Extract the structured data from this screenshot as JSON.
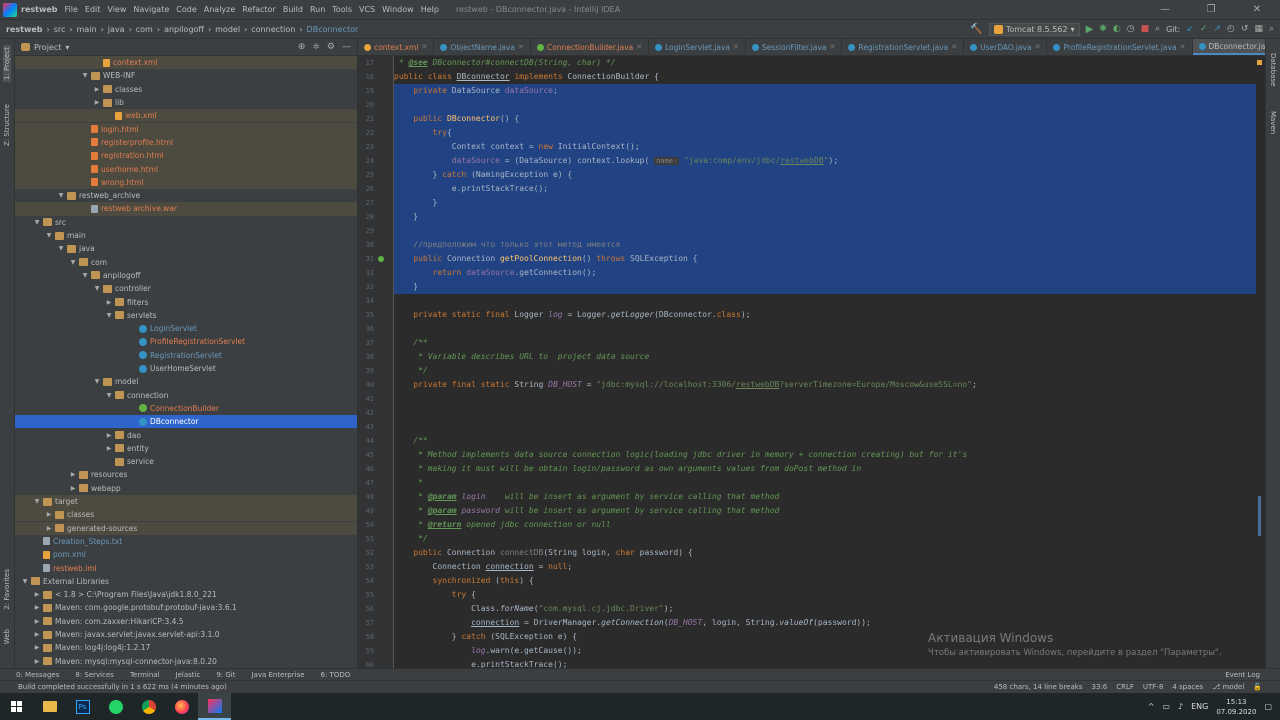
{
  "titlebar": {
    "project": "restweb",
    "menu": [
      "File",
      "Edit",
      "View",
      "Navigate",
      "Code",
      "Analyze",
      "Refactor",
      "Build",
      "Run",
      "Tools",
      "VCS",
      "Window",
      "Help"
    ],
    "title": "restweb - DBconnector.java - IntelliJ IDEA"
  },
  "navbar": {
    "crumbs": [
      "restweb",
      "src",
      "main",
      "java",
      "com",
      "anpilogoff",
      "model",
      "connection",
      "DBconnector"
    ],
    "run_config": "Tomcat 8.5.562",
    "git_label": "Git:"
  },
  "stripes": {
    "left_top": "1: Project",
    "left_structure": "Z: Structure",
    "left_favorites": "2: Favorites",
    "left_web": "Web",
    "right_database": "Database",
    "right_maven": "Maven"
  },
  "project_panel": {
    "title": "Project",
    "rows": [
      {
        "label": "context.xml",
        "color": "orange",
        "icon": "file-xml",
        "indent": 6,
        "arrow": ""
      },
      {
        "label": "WEB-INF",
        "color": "normal",
        "icon": "folder",
        "indent": 5,
        "arrow": "▼"
      },
      {
        "label": "classes",
        "color": "normal",
        "icon": "folder",
        "indent": 6,
        "arrow": "▶"
      },
      {
        "label": "lib",
        "color": "normal",
        "icon": "folder",
        "indent": 6,
        "arrow": "▶"
      },
      {
        "label": "web.xml",
        "color": "orange",
        "icon": "file-xml",
        "indent": 7,
        "arrow": ""
      },
      {
        "label": "login.html",
        "color": "orange",
        "icon": "file-html",
        "indent": 5,
        "arrow": ""
      },
      {
        "label": "registerprofile.html",
        "color": "orange",
        "icon": "file-html",
        "indent": 5,
        "arrow": ""
      },
      {
        "label": "registration.html",
        "color": "orange",
        "icon": "file-html",
        "indent": 5,
        "arrow": ""
      },
      {
        "label": "userhome.html",
        "color": "orange",
        "icon": "file-html",
        "indent": 5,
        "arrow": ""
      },
      {
        "label": "wrong.html",
        "color": "orange",
        "icon": "file-html",
        "indent": 5,
        "arrow": ""
      },
      {
        "label": "restweb_archive",
        "color": "normal",
        "icon": "folder",
        "indent": 3,
        "arrow": "▼"
      },
      {
        "label": "restweb archive.war",
        "color": "orange",
        "icon": "file-war",
        "indent": 5,
        "arrow": ""
      },
      {
        "label": "src",
        "color": "normal",
        "icon": "folder",
        "indent": 1,
        "arrow": "▼"
      },
      {
        "label": "main",
        "color": "normal",
        "icon": "folder",
        "indent": 2,
        "arrow": "▼"
      },
      {
        "label": "java",
        "color": "normal",
        "icon": "folder",
        "indent": 3,
        "arrow": "▼"
      },
      {
        "label": "com",
        "color": "normal",
        "icon": "folder",
        "indent": 4,
        "arrow": "▼"
      },
      {
        "label": "anpilogoff",
        "color": "normal",
        "icon": "folder",
        "indent": 5,
        "arrow": "▼"
      },
      {
        "label": "controller",
        "color": "normal",
        "icon": "folder",
        "indent": 6,
        "arrow": "▼"
      },
      {
        "label": "filters",
        "color": "normal",
        "icon": "folder",
        "indent": 7,
        "arrow": "▶"
      },
      {
        "label": "servlets",
        "color": "normal",
        "icon": "folder",
        "indent": 7,
        "arrow": "▼"
      },
      {
        "label": "LoginServlet",
        "color": "blue",
        "icon": "cls",
        "indent": 9,
        "arrow": ""
      },
      {
        "label": "ProfileRegistrationServlet",
        "color": "orange",
        "icon": "cls",
        "indent": 9,
        "arrow": ""
      },
      {
        "label": "RegistrationServlet",
        "color": "blue",
        "icon": "cls",
        "indent": 9,
        "arrow": ""
      },
      {
        "label": "UserHomeServlet",
        "color": "normal",
        "icon": "cls",
        "indent": 9,
        "arrow": ""
      },
      {
        "label": "model",
        "color": "normal",
        "icon": "folder",
        "indent": 6,
        "arrow": "▼"
      },
      {
        "label": "connection",
        "color": "normal",
        "icon": "folder",
        "indent": 7,
        "arrow": "▼"
      },
      {
        "label": "ConnectionBuilder",
        "color": "orange",
        "icon": "iface",
        "indent": 9,
        "arrow": ""
      },
      {
        "label": "DBconnector",
        "color": "normal",
        "icon": "cls",
        "indent": 9,
        "arrow": "",
        "selected": true
      },
      {
        "label": "dao",
        "color": "normal",
        "icon": "folder",
        "indent": 7,
        "arrow": "▶"
      },
      {
        "label": "entity",
        "color": "normal",
        "icon": "folder",
        "indent": 7,
        "arrow": "▶"
      },
      {
        "label": "service",
        "color": "normal",
        "icon": "folder",
        "indent": 7,
        "arrow": ""
      },
      {
        "label": "resources",
        "color": "normal",
        "icon": "folder",
        "indent": 4,
        "arrow": "▶"
      },
      {
        "label": "webapp",
        "color": "normal",
        "icon": "folder",
        "indent": 4,
        "arrow": "▶"
      },
      {
        "label": "target",
        "color": "normal",
        "icon": "folder",
        "indent": 1,
        "arrow": "▼",
        "hl": true
      },
      {
        "label": "classes",
        "color": "normal",
        "icon": "folder",
        "indent": 2,
        "arrow": "▶",
        "hl": true
      },
      {
        "label": "generated-sources",
        "color": "normal",
        "icon": "folder",
        "indent": 2,
        "arrow": "▶",
        "hl": true
      },
      {
        "label": "Creation_Steps.txt",
        "color": "blue",
        "icon": "file-war",
        "indent": 1,
        "arrow": ""
      },
      {
        "label": "pom.xml",
        "color": "blue",
        "icon": "file-xml",
        "indent": 1,
        "arrow": ""
      },
      {
        "label": "restweb.iml",
        "color": "orange",
        "icon": "file-war",
        "indent": 1,
        "arrow": ""
      },
      {
        "label": "External Libraries",
        "color": "normal",
        "icon": "folder",
        "indent": 0,
        "arrow": "▼"
      },
      {
        "label": "< 1.8 >  C:\\Program Files\\Java\\jdk1.8.0_221",
        "color": "normal",
        "icon": "folder",
        "indent": 1,
        "arrow": "▶"
      },
      {
        "label": "Maven: com.google.protobuf:protobuf-java:3.6.1",
        "color": "normal",
        "icon": "folder",
        "indent": 1,
        "arrow": "▶"
      },
      {
        "label": "Maven: com.zaxxer:HikariCP:3.4.5",
        "color": "normal",
        "icon": "folder",
        "indent": 1,
        "arrow": "▶"
      },
      {
        "label": "Maven: javax.servlet:javax.servlet-api:3.1.0",
        "color": "normal",
        "icon": "folder",
        "indent": 1,
        "arrow": "▶"
      },
      {
        "label": "Maven: log4j:log4j:1.2.17",
        "color": "normal",
        "icon": "folder",
        "indent": 1,
        "arrow": "▶"
      },
      {
        "label": "Maven: mysql:mysql-connector-java:8.0.20",
        "color": "normal",
        "icon": "folder",
        "indent": 1,
        "arrow": "▶"
      }
    ]
  },
  "tabs": [
    {
      "label": "context.xml",
      "color": "#e8a33c"
    },
    {
      "label": "ObjectName.java",
      "color": "#3592c4"
    },
    {
      "label": "ConnectionBuilder.java",
      "color": "#62b543"
    },
    {
      "label": "LoginServlet.java",
      "color": "#3592c4"
    },
    {
      "label": "SessionFilter.java",
      "color": "#3592c4"
    },
    {
      "label": "RegistrationServlet.java",
      "color": "#3592c4"
    },
    {
      "label": "UserDAO.java",
      "color": "#3592c4"
    },
    {
      "label": "ProfileRegistrationServlet.java",
      "color": "#3592c4"
    },
    {
      "label": "DBconnector.java",
      "color": "#3592c4",
      "active": true
    }
  ],
  "code": {
    "lines": [
      {
        "n": "17",
        "html": "<span class='doc'> * <span class='tag'>@see</span> DBconnector#connectDB(String, char) */</span>"
      },
      {
        "n": "18",
        "html": "<span class='kw'>public class</span> <span class='ul'>DBconnector</span> <span class='kw'>implements</span> ConnectionBuilder {"
      },
      {
        "n": "19",
        "html": "    <span class='kw'>private</span> DataSource <span class='fld'>dataSource</span>;",
        "sel": true
      },
      {
        "n": "20",
        "html": "",
        "sel": true
      },
      {
        "n": "21",
        "html": "    <span class='kw'>public</span> <span class='fn'>DBconnector</span>() {",
        "sel": true
      },
      {
        "n": "22",
        "html": "        <span class='kw'>try</span>{",
        "sel": true
      },
      {
        "n": "23",
        "html": "            Context context = <span class='kw'>new</span> InitialContext();",
        "sel": true
      },
      {
        "n": "24",
        "html": "            <span class='fld'>dataSource</span> = (DataSource) context.lookup( <span class='hint'>name:</span> <span class='str'>\"java:comp/env/jdbc/<span class='ul'>restwebDB</span>\"</span>);",
        "sel": true
      },
      {
        "n": "25",
        "html": "        } <span class='kw'>catch</span> (NamingException e) {",
        "sel": true
      },
      {
        "n": "26",
        "html": "            e.printStackTrace();",
        "sel": true
      },
      {
        "n": "27",
        "html": "        }",
        "sel": true
      },
      {
        "n": "28",
        "html": "    }",
        "sel": true
      },
      {
        "n": "29",
        "html": "",
        "sel": true
      },
      {
        "n": "30",
        "html": "    <span class='cmt'>//предположим что только этот метод имеется</span>",
        "sel": true
      },
      {
        "n": "31",
        "html": "    <span class='kw'>public</span> Connection <span class='fn'>getPoolConnection</span>() <span class='kw'>throws</span> SQLException {",
        "sel": true
      },
      {
        "n": "32",
        "html": "        <span class='kw'>return</span> <span class='fld'>dataSource</span>.getConnection();",
        "sel": true
      },
      {
        "n": "33",
        "html": "    }",
        "sel": true,
        "cur": true
      },
      {
        "n": "34",
        "html": ""
      },
      {
        "n": "35",
        "html": "    <span class='kw'>private static final</span> Logger <span class='fld it'>log</span> = Logger.<span class='it'>getLogger</span>(DBconnector.<span class='kw'>class</span>);"
      },
      {
        "n": "36",
        "html": ""
      },
      {
        "n": "37",
        "html": "    <span class='doc'>/**</span>"
      },
      {
        "n": "38",
        "html": "    <span class='doc'> * Variable describes URL to  project data source</span>"
      },
      {
        "n": "39",
        "html": "    <span class='doc'> */</span>"
      },
      {
        "n": "40",
        "html": "    <span class='kw'>private final static</span> String <span class='fld it'>DB_HOST</span> = <span class='str'>\"jdbc:mysql://localhost:3306/<span class='ul'>restwebDB</span>?serverTimezone=Europe/Moscow&amp;useSSL=no\"</span>;"
      },
      {
        "n": "41",
        "html": ""
      },
      {
        "n": "42",
        "html": ""
      },
      {
        "n": "43",
        "html": ""
      },
      {
        "n": "44",
        "html": "    <span class='doc'>/**</span>"
      },
      {
        "n": "45",
        "html": "    <span class='doc'> * Method implements data source connection logic(loading jdbc driver in memory + connection creating) but for it's</span>"
      },
      {
        "n": "46",
        "html": "    <span class='doc'> * making it must will be obtain login/password as own arguments values from doPost method in</span>"
      },
      {
        "n": "47",
        "html": "    <span class='doc'> *</span>"
      },
      {
        "n": "48",
        "html": "    <span class='doc'> * <span class='tag'>@param</span> <span class='fld'>login</span>    will be insert as argument by service calling that method</span>"
      },
      {
        "n": "49",
        "html": "    <span class='doc'> * <span class='tag'>@param</span> <span class='fld'>password</span> will be insert as argument by service calling that method</span>"
      },
      {
        "n": "50",
        "html": "    <span class='doc'> * <span class='tag'>@return</span> opened jdbc connection or null</span>"
      },
      {
        "n": "51",
        "html": "    <span class='doc'> */</span>"
      },
      {
        "n": "52",
        "html": "    <span class='kw'>public</span> Connection <span class='cmt'>connectDB</span>(String login, <span class='kw'>char</span> password) {"
      },
      {
        "n": "53",
        "html": "        Connection <span class='ul'>connection</span> = <span class='kw'>null</span>;"
      },
      {
        "n": "54",
        "html": "        <span class='kw'>synchronized</span> (<span class='kw'>this</span>) {"
      },
      {
        "n": "55",
        "html": "            <span class='kw'>try</span> {"
      },
      {
        "n": "56",
        "html": "                Class.<span class='it'>forName</span>(<span class='str'>\"com.mysql.cj.jdbc.Driver\"</span>);"
      },
      {
        "n": "57",
        "html": "                <span class='ul'>connection</span> = DriverManager.<span class='it'>getConnection</span>(<span class='fld it'>DB_HOST</span>, login, String.<span class='it'>valueOf</span>(password));"
      },
      {
        "n": "58",
        "html": "            } <span class='kw'>catch</span> (SQLException e) {"
      },
      {
        "n": "59",
        "html": "                <span class='fld it'>log</span>.warn(e.getCause());"
      },
      {
        "n": "60",
        "html": "                e.printStackTrace();"
      }
    ]
  },
  "watermark": {
    "line1": "Активация Windows",
    "line2": "Чтобы активировать Windows, перейдите в раздел \"Параметры\"."
  },
  "bottom_tabs": [
    "0: Messages",
    "8: Services",
    "Terminal",
    "Jelastic",
    "9: Git",
    "Java Enterprise",
    "6: TODO"
  ],
  "event_log": "Event Log",
  "status": {
    "message": "Build completed successfully in 1 s 622 ms (4 minutes ago)",
    "chars": "458 chars, 14 line breaks",
    "position": "33:6",
    "line_sep": "CRLF",
    "encoding": "UTF-8",
    "indent": "4 spaces",
    "branch": "model"
  },
  "taskbar": {
    "lang": "ENG",
    "time": "15:13",
    "date": "07.09.2020"
  }
}
